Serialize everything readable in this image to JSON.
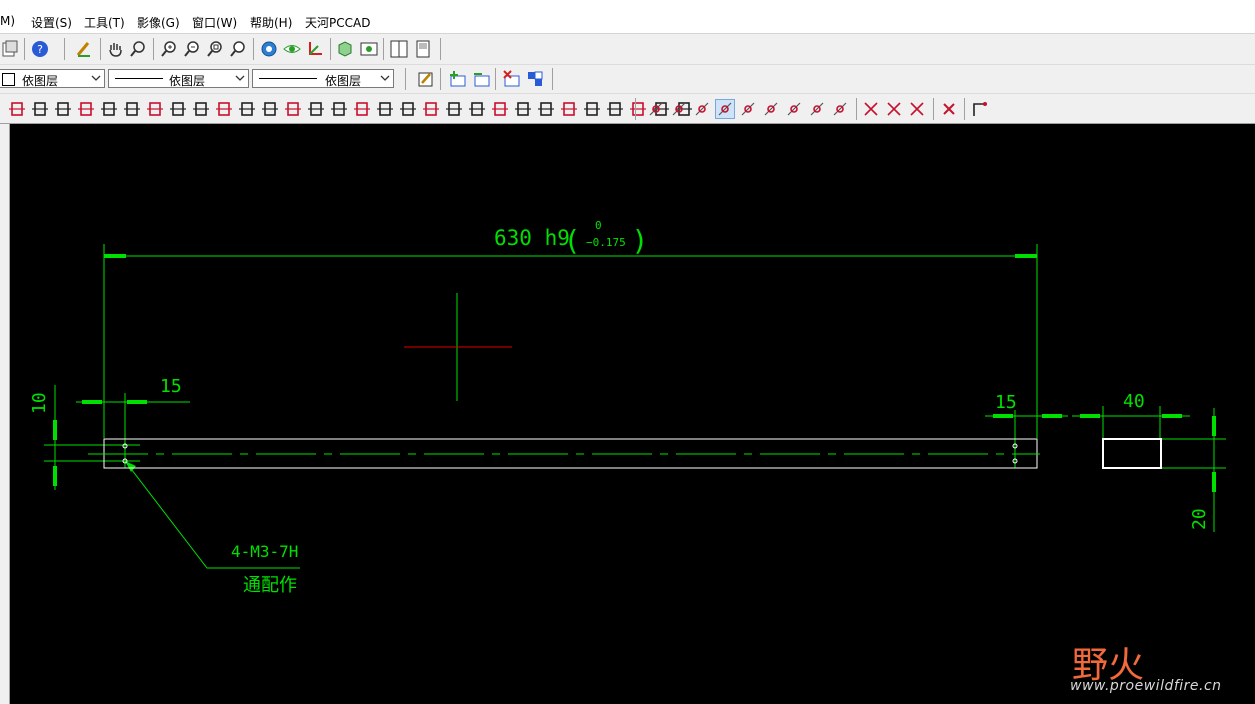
{
  "menu": {
    "items": [
      "M)",
      "设置(S)",
      "工具(T)",
      "影像(G)",
      "窗口(W)",
      "帮助(H)",
      "天河PCCAD"
    ]
  },
  "toolbar2": {
    "color_combo": "依图层",
    "linetype_combo": "依图层",
    "lineweight_combo": "依图层"
  },
  "drawing": {
    "overall_dim": "630 h9",
    "tol_upper": "0",
    "tol_lower": "−0.175",
    "dim_left_15": "15",
    "dim_right_15": "15",
    "dim_left_10": "10",
    "dim_side_40": "40",
    "dim_side_20": "20",
    "leader_label": "4-M3-7H",
    "leader_note": "通配作",
    "colors": {
      "dim": "#00e000",
      "outline": "#ffffff",
      "cross_red": "#e00000"
    }
  },
  "watermark": {
    "cn": "野火",
    "url": "www.proewildfire.cn"
  }
}
